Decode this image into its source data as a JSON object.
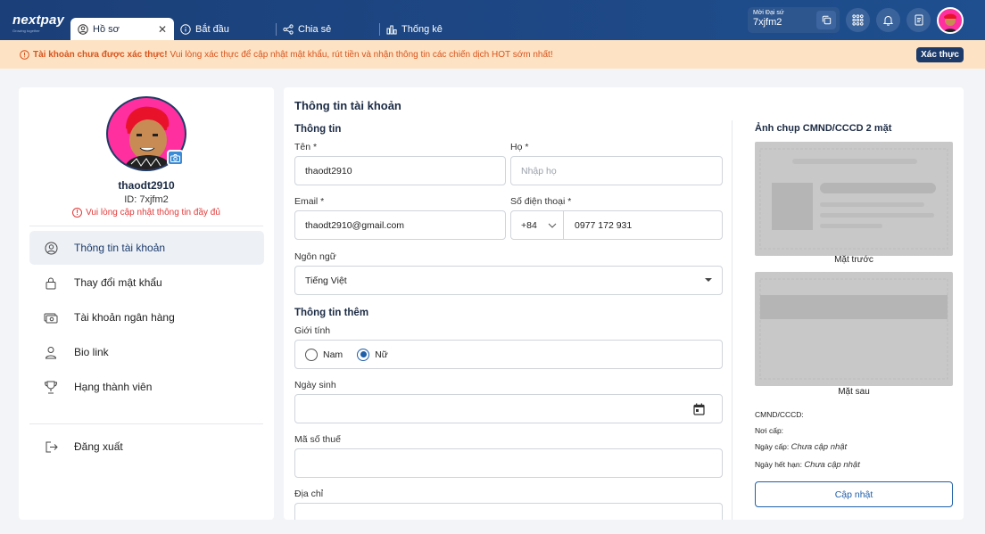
{
  "header": {
    "logo": "nextpay",
    "logo_sub": "Growing together",
    "tabs": [
      {
        "label": "Hồ sơ",
        "active": true
      },
      {
        "label": "Bắt đầu"
      },
      {
        "label": "Chia sẻ"
      },
      {
        "label": "Thống kê"
      }
    ],
    "referral": {
      "label": "Mời Đại sứ",
      "code": "7xjfm2"
    }
  },
  "banner": {
    "bold": "Tài khoản chưa được xác thực!",
    "text": "Vui lòng xác thực để cập nhật mật khẩu, rút tiền và nhận thông tin các chiến dịch HOT sớm nhất!",
    "button": "Xác thực"
  },
  "profile": {
    "username": "thaodt2910",
    "id_text": "ID: 7xjfm2",
    "warning": "Vui lòng cập nhật thông tin đầy đủ"
  },
  "menu": [
    {
      "label": "Thông tin tài khoản",
      "active": true
    },
    {
      "label": "Thay đổi mật khẩu"
    },
    {
      "label": "Tài khoản ngân hàng"
    },
    {
      "label": "Bio link"
    },
    {
      "label": "Hạng thành viên"
    }
  ],
  "logout": "Đăng xuất",
  "form": {
    "title": "Thông tin tài khoản",
    "section_info": "Thông tin",
    "first_name_label": "Tên *",
    "first_name_value": "thaodt2910",
    "last_name_label": "Họ *",
    "last_name_placeholder": "Nhập họ",
    "email_label": "Email *",
    "email_value": "thaodt2910@gmail.com",
    "phone_label": "Số điện thoại *",
    "phone_prefix": "+84",
    "phone_value": "0977 172 931",
    "language_label": "Ngôn ngữ",
    "language_value": "Tiếng Việt",
    "section_more": "Thông tin thêm",
    "gender_label": "Giới tính",
    "gender_male": "Nam",
    "gender_female": "Nữ",
    "birthday_label": "Ngày sinh",
    "tax_label": "Mã số thuế",
    "address_label": "Địa chỉ"
  },
  "id_section": {
    "title": "Ảnh chụp CMND/CCCD 2 mặt",
    "front": "Mặt trước",
    "back": "Mặt sau",
    "id_number_label": "CMND/CCCD:",
    "issue_place_label": "Nơi cấp:",
    "issue_date_label": "Ngày cấp:",
    "issue_date_value": "Chưa cập nhật",
    "expiry_label": "Ngày hết hạn:",
    "expiry_value": "Chưa cập nhật",
    "update_button": "Cập nhật"
  }
}
